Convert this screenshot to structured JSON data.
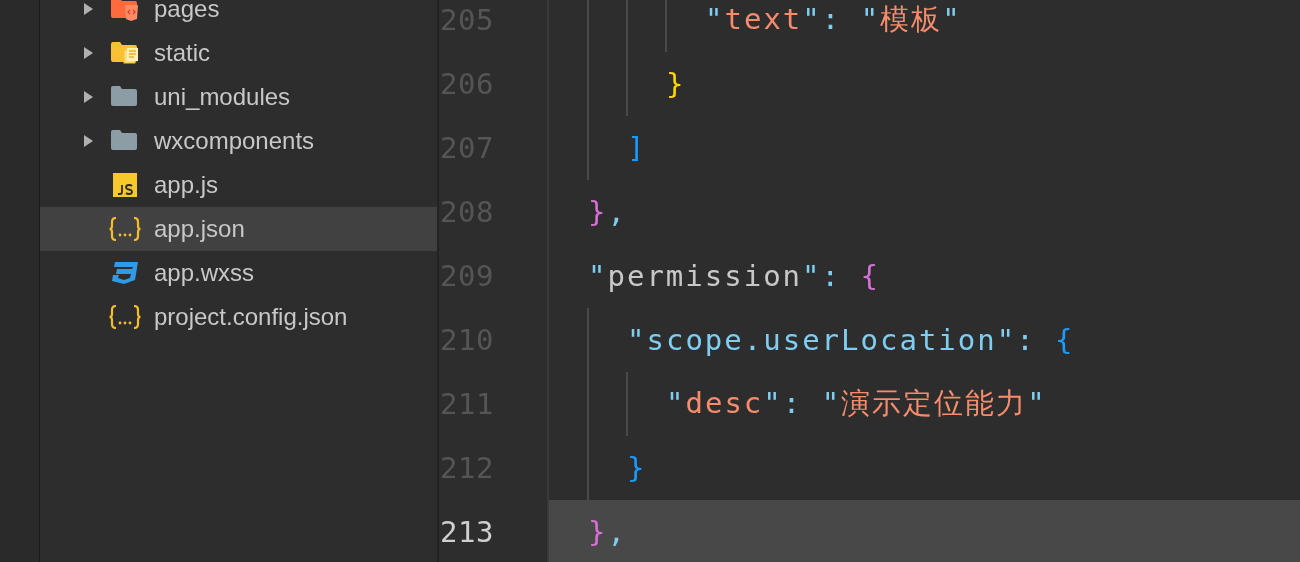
{
  "file_tree": [
    {
      "name": "pages",
      "kind": "folder-pages",
      "expanded": false,
      "selected": false
    },
    {
      "name": "static",
      "kind": "folder-static",
      "expanded": false,
      "selected": false
    },
    {
      "name": "uni_modules",
      "kind": "folder",
      "expanded": false,
      "selected": false
    },
    {
      "name": "wxcomponents",
      "kind": "folder",
      "expanded": false,
      "selected": false
    },
    {
      "name": "app.js",
      "kind": "js",
      "selected": false
    },
    {
      "name": "app.json",
      "kind": "json",
      "selected": true
    },
    {
      "name": "app.wxss",
      "kind": "css",
      "selected": false
    },
    {
      "name": "project.config.json",
      "kind": "json",
      "selected": false
    }
  ],
  "editor": {
    "lines": [
      {
        "children": [
          {
            "children": [
              {
                "children": [
                  {
                    "number": "205",
                    "current": false,
                    "tokens": [
                      {
                        "text": "\"",
                        "color": "#7fcdf0"
                      },
                      {
                        "text": "text",
                        "color": "#f78c6c"
                      },
                      {
                        "text": "\": \"",
                        "color": "#7fcdf0"
                      },
                      {
                        "text": "模板",
                        "color": "#f78c6c"
                      },
                      {
                        "text": "\"",
                        "color": "#7fcdf0"
                      }
                    ]
                  }
                ]
              },
              {
                "number": "206",
                "current": false,
                "tokens": [
                  {
                    "text": "}",
                    "color": "#ffd700"
                  }
                ]
              }
            ]
          },
          {
            "number": "207",
            "current": false,
            "tokens": [
              {
                "text": "]",
                "color": "#1a9bff"
              }
            ]
          }
        ]
      },
      {
        "number": "208",
        "current": false,
        "tokens": [
          {
            "text": "}",
            "color": "#d670d6"
          },
          {
            "text": ",",
            "color": "#7fcdf0"
          }
        ]
      },
      {
        "number": "209",
        "current": false,
        "tokens": [
          {
            "text": "\"",
            "color": "#7fcdf0"
          },
          {
            "text": "permission",
            "color": "#c8c8c8"
          },
          {
            "text": "\": ",
            "color": "#7fcdf0"
          },
          {
            "text": "{",
            "color": "#d670d6"
          }
        ],
        "children": [
          {
            "number": "210",
            "current": false,
            "tokens": [
              {
                "text": "\"scope.userLocation\": ",
                "color": "#7fcdf0"
              },
              {
                "text": "{",
                "color": "#1a9bff"
              }
            ],
            "children": [
              {
                "number": "211",
                "current": false,
                "tokens": [
                  {
                    "text": "\"",
                    "color": "#7fcdf0"
                  },
                  {
                    "text": "desc",
                    "color": "#f78c6c"
                  },
                  {
                    "text": "\": \"",
                    "color": "#7fcdf0"
                  },
                  {
                    "text": "演示定位能力",
                    "color": "#f78c6c"
                  },
                  {
                    "text": "\"",
                    "color": "#7fcdf0"
                  }
                ]
              }
            ]
          },
          {
            "number": "212",
            "current": false,
            "tokens": [
              {
                "text": "}",
                "color": "#1a9bff"
              }
            ]
          }
        ]
      },
      {
        "number": "213",
        "current": true,
        "tokens": [
          {
            "text": "}",
            "color": "#d670d6"
          },
          {
            "text": ",",
            "color": "#7fcdf0"
          }
        ]
      }
    ]
  }
}
